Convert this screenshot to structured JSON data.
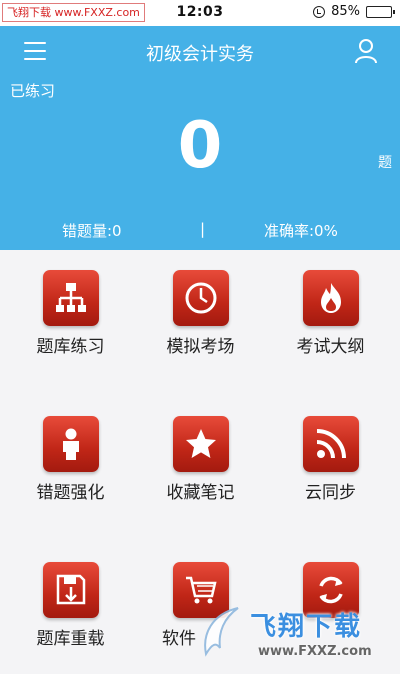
{
  "status_bar": {
    "watermark": "飞翔下载 www.FXXZ.com",
    "time": "12:03",
    "battery": "85%",
    "battery_level": 0.85
  },
  "header": {
    "title": "初级会计实务",
    "practiced_label": "已练习",
    "practiced_count": "0",
    "count_unit": "题",
    "wrong_count": "错题量:0",
    "divider": "|",
    "accuracy": "准确率:0%",
    "background_color": "#45b1e7"
  },
  "grid": {
    "items": [
      {
        "label": "题库练习",
        "icon": "sitemap-icon"
      },
      {
        "label": "模拟考场",
        "icon": "clock-icon"
      },
      {
        "label": "考试大纲",
        "icon": "flame-icon"
      },
      {
        "label": "错题强化",
        "icon": "person-icon"
      },
      {
        "label": "收藏笔记",
        "icon": "star-icon"
      },
      {
        "label": "云同步",
        "icon": "rss-icon"
      },
      {
        "label": "题库重载",
        "icon": "save-download-icon"
      },
      {
        "label": "软件",
        "icon": "cart-icon"
      },
      {
        "label": "",
        "icon": "refresh-icon"
      }
    ],
    "tile_color": "#c62a1a"
  },
  "watermark_logo": {
    "brand": "飞翔下载",
    "domain": "www.FXXZ.com"
  }
}
